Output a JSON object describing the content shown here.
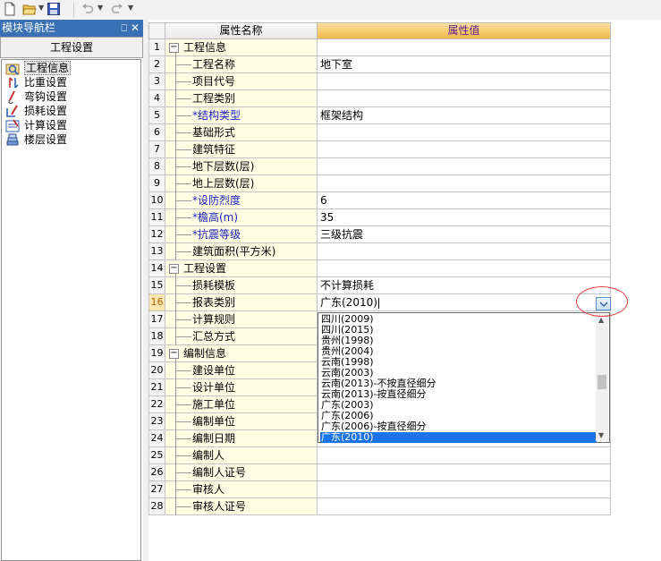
{
  "toolbar": {
    "buttons": [
      {
        "name": "new-file-icon"
      },
      {
        "name": "open-folder-icon"
      },
      {
        "name": "save-icon"
      },
      {
        "name": "undo-icon"
      },
      {
        "name": "redo-icon"
      }
    ]
  },
  "nav": {
    "title": "模块导航栏",
    "pin_glyph": "⎕",
    "close_glyph": "✕",
    "group_label": "工程设置",
    "items": [
      {
        "label": "工程信息",
        "icon": "project-info-icon",
        "selected": true
      },
      {
        "label": "比重设置",
        "icon": "density-icon",
        "selected": false
      },
      {
        "label": "弯钩设置",
        "icon": "hook-icon",
        "selected": false
      },
      {
        "label": "损耗设置",
        "icon": "loss-icon",
        "selected": false
      },
      {
        "label": "计算设置",
        "icon": "calc-icon",
        "selected": false
      },
      {
        "label": "楼层设置",
        "icon": "floor-icon",
        "selected": false
      }
    ]
  },
  "grid": {
    "header": {
      "name": "属性名称",
      "value": "属性值"
    },
    "rows": [
      {
        "num": "1",
        "type": "group",
        "name": "工程信息",
        "toggle": "−",
        "value": ""
      },
      {
        "num": "2",
        "type": "child",
        "name": "工程名称",
        "required": false,
        "value": "地下室"
      },
      {
        "num": "3",
        "type": "child",
        "name": "项目代号",
        "required": false,
        "value": ""
      },
      {
        "num": "4",
        "type": "child",
        "name": "工程类别",
        "required": false,
        "value": ""
      },
      {
        "num": "5",
        "type": "child",
        "name": "*结构类型",
        "required": true,
        "value": "框架结构"
      },
      {
        "num": "6",
        "type": "child",
        "name": "基础形式",
        "required": false,
        "value": ""
      },
      {
        "num": "7",
        "type": "child",
        "name": "建筑特征",
        "required": false,
        "value": ""
      },
      {
        "num": "8",
        "type": "child",
        "name": "地下层数(层)",
        "required": false,
        "value": ""
      },
      {
        "num": "9",
        "type": "child",
        "name": "地上层数(层)",
        "required": false,
        "value": ""
      },
      {
        "num": "10",
        "type": "child",
        "name": "*设防烈度",
        "required": true,
        "value": "6"
      },
      {
        "num": "11",
        "type": "child",
        "name": "*檐高(m)",
        "required": true,
        "value": "35"
      },
      {
        "num": "12",
        "type": "child",
        "name": "*抗震等级",
        "required": true,
        "value": "三级抗震"
      },
      {
        "num": "13",
        "type": "child",
        "name": "建筑面积(平方米)",
        "required": false,
        "value": ""
      },
      {
        "num": "14",
        "type": "group",
        "name": "工程设置",
        "toggle": "−",
        "value": ""
      },
      {
        "num": "15",
        "type": "child",
        "name": "损耗模板",
        "required": false,
        "value": "不计算损耗"
      },
      {
        "num": "16",
        "type": "child",
        "name": "报表类别",
        "required": false,
        "value": "广东(2010)",
        "editing": true
      },
      {
        "num": "17",
        "type": "child",
        "name": "计算规则",
        "required": false,
        "value": ""
      },
      {
        "num": "18",
        "type": "child",
        "name": "汇总方式",
        "required": false,
        "value": ""
      },
      {
        "num": "19",
        "type": "group",
        "name": "编制信息",
        "toggle": "−",
        "value": ""
      },
      {
        "num": "20",
        "type": "child",
        "name": "建设单位",
        "required": false,
        "value": ""
      },
      {
        "num": "21",
        "type": "child",
        "name": "设计单位",
        "required": false,
        "value": ""
      },
      {
        "num": "22",
        "type": "child",
        "name": "施工单位",
        "required": false,
        "value": ""
      },
      {
        "num": "23",
        "type": "child",
        "name": "编制单位",
        "required": false,
        "value": ""
      },
      {
        "num": "24",
        "type": "child",
        "name": "编制日期",
        "required": false,
        "value": ""
      },
      {
        "num": "25",
        "type": "child",
        "name": "编制人",
        "required": false,
        "value": ""
      },
      {
        "num": "26",
        "type": "child",
        "name": "编制人证号",
        "required": false,
        "value": ""
      },
      {
        "num": "27",
        "type": "child",
        "name": "审核人",
        "required": false,
        "value": ""
      },
      {
        "num": "28",
        "type": "child",
        "name": "审核人证号",
        "required": false,
        "value": ""
      }
    ],
    "active_row": "16"
  },
  "dropdown": {
    "options": [
      "四川(2009)",
      "四川(2015)",
      "贵州(1998)",
      "贵州(2004)",
      "云南(1998)",
      "云南(2003)",
      "云南(2013)-不按直径细分",
      "云南(2013)-按直径细分",
      "广东(2003)",
      "广东(2006)",
      "广东(2006)-按直径细分",
      "广东(2010)"
    ],
    "selected": "广东(2010)",
    "scroll_position": 0.55
  },
  "colors": {
    "title_bar": "#3a71b5",
    "header_value_bg": "#f4b84a",
    "header_value_text": "#5a1a8c",
    "name_cell_bg": "#ffffe6",
    "required_text": "#1c1cbf",
    "selection": "#1a73e8",
    "annotation": "#e43a3a"
  }
}
